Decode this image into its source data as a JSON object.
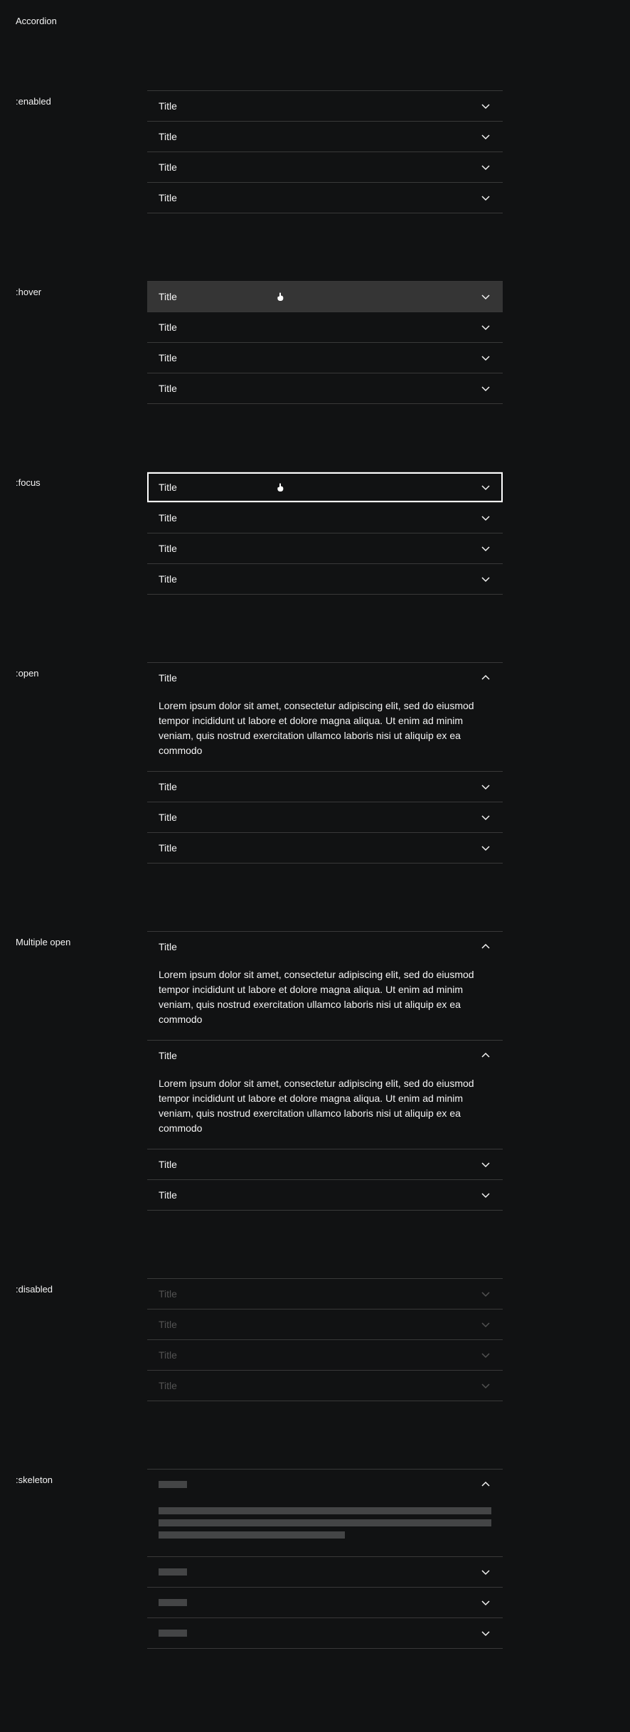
{
  "pageTitle": "Accordion",
  "states": {
    "enabled": {
      "label": ":enabled",
      "items": [
        "Title",
        "Title",
        "Title",
        "Title"
      ]
    },
    "hover": {
      "label": ":hover",
      "items": [
        "Title",
        "Title",
        "Title",
        "Title"
      ]
    },
    "focus": {
      "label": ":focus",
      "items": [
        "Title",
        "Title",
        "Title",
        "Title"
      ]
    },
    "open": {
      "label": ":open",
      "items": [
        "Title",
        "Title",
        "Title",
        "Title"
      ],
      "content": "Lorem ipsum dolor sit amet, consectetur adipiscing elit, sed do eiusmod tempor incididunt ut labore et dolore magna aliqua. Ut enim ad minim veniam, quis nostrud exercitation ullamco laboris nisi ut aliquip ex ea commodo"
    },
    "multiple": {
      "label": "Multiple open",
      "items": [
        "Title",
        "Title",
        "Title",
        "Title"
      ],
      "content": "Lorem ipsum dolor sit amet, consectetur adipiscing elit, sed do eiusmod tempor incididunt ut labore et dolore magna aliqua. Ut enim ad minim veniam, quis nostrud exercitation ullamco laboris nisi ut aliquip ex ea commodo"
    },
    "disabled": {
      "label": ":disabled",
      "items": [
        "Title",
        "Title",
        "Title",
        "Title"
      ]
    },
    "skeleton": {
      "label": ":skeleton"
    }
  }
}
